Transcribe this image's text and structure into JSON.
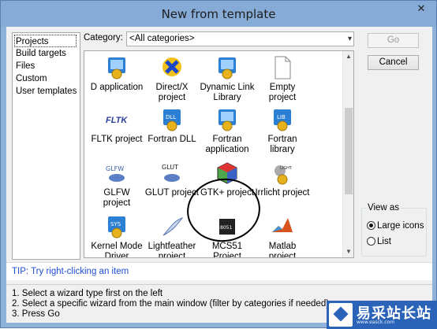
{
  "window": {
    "title": "New from template",
    "close_glyph": "✕"
  },
  "left_panel": {
    "items": [
      {
        "label": "Projects",
        "selected": true
      },
      {
        "label": "Build targets",
        "selected": false
      },
      {
        "label": "Files",
        "selected": false
      },
      {
        "label": "Custom",
        "selected": false
      },
      {
        "label": "User templates",
        "selected": false
      }
    ]
  },
  "category": {
    "label": "Category:",
    "value": "<All categories>"
  },
  "templates": [
    {
      "label": "D application",
      "icon": "gear-icon"
    },
    {
      "label": "Direct/X project",
      "icon": "directx-icon"
    },
    {
      "label": "Dynamic Link Library",
      "icon": "dll-icon"
    },
    {
      "label": "Empty project",
      "icon": "document-icon"
    },
    {
      "label": "FLTK project",
      "icon": "fltk-icon"
    },
    {
      "label": "Fortran DLL",
      "icon": "dll-icon"
    },
    {
      "label": "Fortran application",
      "icon": "gear-icon"
    },
    {
      "label": "Fortran library",
      "icon": "lib-icon"
    },
    {
      "label": "GLFW project",
      "icon": "glfw-icon"
    },
    {
      "label": "GLUT project",
      "icon": "glut-icon"
    },
    {
      "label": "GTK+ project",
      "icon": "gtk-icon"
    },
    {
      "label": "Irrlicht project",
      "icon": "irrlicht-icon"
    },
    {
      "label": "Kernel Mode Driver",
      "icon": "sys-icon"
    },
    {
      "label": "Lightfeather project",
      "icon": "feather-icon"
    },
    {
      "label": "MCS51 Project",
      "icon": "chip-icon"
    },
    {
      "label": "Matlab project",
      "icon": "matlab-icon"
    }
  ],
  "glyphs": {
    "glfw": "GLFW",
    "glut": "GLUT",
    "fltk": "FLTK",
    "dll": "DLL",
    "lib": "LIB",
    "sys": "SYS",
    "directx": "✕",
    "feather": "❦",
    "chip": "8051",
    "light": "LIGHT",
    "arrow_down": "▾",
    "scroll_up": "▲",
    "scroll_down": "▼"
  },
  "buttons": {
    "go": "Go",
    "cancel": "Cancel"
  },
  "view_as": {
    "legend": "View as",
    "options": [
      {
        "label": "Large icons",
        "checked": true
      },
      {
        "label": "List",
        "checked": false
      }
    ]
  },
  "tip": "TIP: Try right-clicking an item",
  "steps": [
    "1. Select a wizard type first on the left",
    "2. Select a specific wizard from the main window (filter by categories if needed)",
    "3. Press Go"
  ],
  "watermark": {
    "title": "易采站长站",
    "subtitle": "www.easck.com"
  },
  "colors": {
    "accent": "#1f4fd6",
    "titlebar": "#86abd6",
    "watermark": "#2a63b8"
  }
}
